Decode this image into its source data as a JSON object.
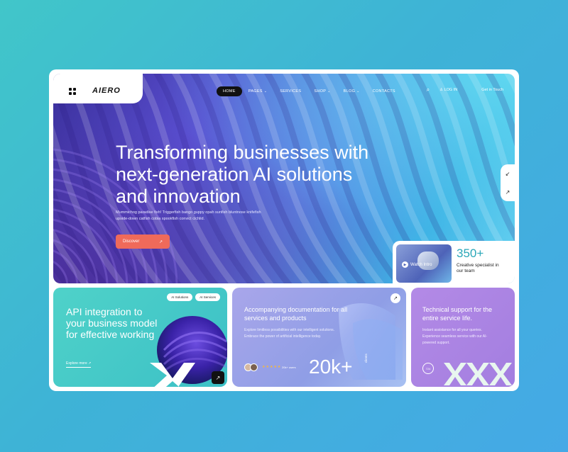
{
  "header": {
    "logo": "AIERO",
    "nav": [
      {
        "label": "HOME",
        "active": true,
        "caret": false
      },
      {
        "label": "PAGES",
        "active": false,
        "caret": true
      },
      {
        "label": "SERVICES",
        "active": false,
        "caret": false
      },
      {
        "label": "SHOP",
        "active": false,
        "caret": true
      },
      {
        "label": "BLOG",
        "active": false,
        "caret": true
      },
      {
        "label": "CONTACTS",
        "active": false,
        "caret": false
      }
    ],
    "login_label": "LOG IN",
    "cta_label": "Get in Touch"
  },
  "hero": {
    "title": "Transforming businesses with next-generation AI solutions and innovation",
    "subtitle": "Mummichog paradise fish! Triggerfish bango guppy opah sunfish bluntnose knifefish upside-down catfish cobia spookfish convict cichlid.",
    "discover_label": "Discover",
    "stat": {
      "value": "350+",
      "label": "Creative specialist in our team",
      "video_label": "Watch Intro"
    }
  },
  "cards": {
    "api": {
      "pills": [
        "AI Solutions",
        "AI Services"
      ],
      "title": "API integration to your business model for effective working",
      "link_label": "Explore more"
    },
    "docs": {
      "title": "Accompanying documentation for all services and products",
      "body": "Explore limitless possibilities with our intelligent solutions. Embrace the power of artificial intelligence today.",
      "rating_text": "20k+ users",
      "big_number": "20k+",
      "vertical_label": "clients"
    },
    "support": {
      "title": "Technical support for the entire service life.",
      "body": "Instant assistance for all your queries. Experience seamless service with our AI-powered support.",
      "badge": "724"
    }
  },
  "colors": {
    "accent": "#ef6a5a",
    "stat_number": "#2aa7b8",
    "card_teal": "#4fd2c9",
    "card_periwinkle": "#a9a6ea",
    "card_purple": "#b38ae6"
  },
  "icons": [
    "grid-icon",
    "search-icon",
    "user-icon",
    "arrow-up-right-icon",
    "arrow-down-left-icon",
    "play-icon",
    "star-icon"
  ]
}
